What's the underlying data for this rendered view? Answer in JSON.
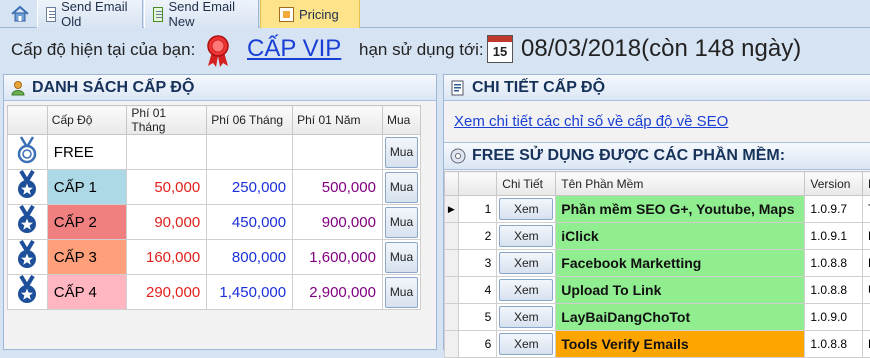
{
  "tabs": {
    "home_icon": "home-icon",
    "items": [
      {
        "label": "Send Email Old",
        "active": false
      },
      {
        "label": "Send Email New",
        "active": false
      },
      {
        "label": "Pricing",
        "active": true
      }
    ]
  },
  "level": {
    "current_label": "Cấp độ hiện tại của bạn:",
    "current_value": "CẤP VIP",
    "expiry_label": "hạn sử dụng tới:",
    "calendar_day": "15",
    "expiry_value": "08/03/2018(còn 148 ngày)"
  },
  "levels_panel": {
    "title": "DANH SÁCH CẤP ĐỘ",
    "columns": [
      "Cấp Độ",
      "Phí 01 Tháng",
      "Phí 06 Tháng",
      "Phí 01 Năm",
      "Mua"
    ],
    "rows": [
      {
        "name": "FREE",
        "m1": "",
        "m6": "",
        "y1": "",
        "buy": "Mua",
        "bg": "#ffffff"
      },
      {
        "name": "CẤP 1",
        "m1": "50,000",
        "m6": "250,000",
        "y1": "500,000",
        "buy": "Mua",
        "bg": "#add8e6"
      },
      {
        "name": "CẤP 2",
        "m1": "90,000",
        "m6": "450,000",
        "y1": "900,000",
        "buy": "Mua",
        "bg": "#f08080"
      },
      {
        "name": "CẤP 3",
        "m1": "160,000",
        "m6": "800,000",
        "y1": "1,600,000",
        "buy": "Mua",
        "bg": "#ffa07a"
      },
      {
        "name": "CẤP 4",
        "m1": "290,000",
        "m6": "1,450,000",
        "y1": "2,900,000",
        "buy": "Mua",
        "bg": "#ffb6c1"
      }
    ],
    "colors": {
      "m1": "#e0201c",
      "m6": "#1a2fd8",
      "y1": "#800080"
    }
  },
  "detail_panel": {
    "title": "CHI TIẾT CẤP ĐỘ",
    "link": "Xem chi tiết các chỉ số về cấp độ về SEO",
    "software_title": "FREE SỬ DỤNG ĐƯỢC CÁC PHẦN MỀM:",
    "columns": [
      "",
      "",
      "Chi Tiết",
      "Tên Phần Mềm",
      "Version",
      "M"
    ],
    "rows": [
      {
        "index": "1",
        "btn": "Xem",
        "name": "Phần mềm SEO G+, Youtube, Maps",
        "version": "1.0.9.7",
        "m": "T",
        "bg": "#90ee90",
        "current": true
      },
      {
        "index": "2",
        "btn": "Xem",
        "name": "iClick",
        "version": "1.0.9.1",
        "m": "N",
        "bg": "#90ee90",
        "current": false
      },
      {
        "index": "3",
        "btn": "Xem",
        "name": "Facebook Marketting",
        "version": "1.0.8.8",
        "m": "P",
        "bg": "#90ee90",
        "current": false
      },
      {
        "index": "4",
        "btn": "Xem",
        "name": "Upload To Link",
        "version": "1.0.8.8",
        "m": "U",
        "bg": "#90ee90",
        "current": false
      },
      {
        "index": "5",
        "btn": "Xem",
        "name": "LayBaiDangChoTot",
        "version": "1.0.9.0",
        "m": "",
        "bg": "#90ee90",
        "current": false
      },
      {
        "index": "6",
        "btn": "Xem",
        "name": "Tools Verify Emails",
        "version": "1.0.8.8",
        "m": "P",
        "bg": "#ffa500",
        "current": false
      }
    ]
  }
}
